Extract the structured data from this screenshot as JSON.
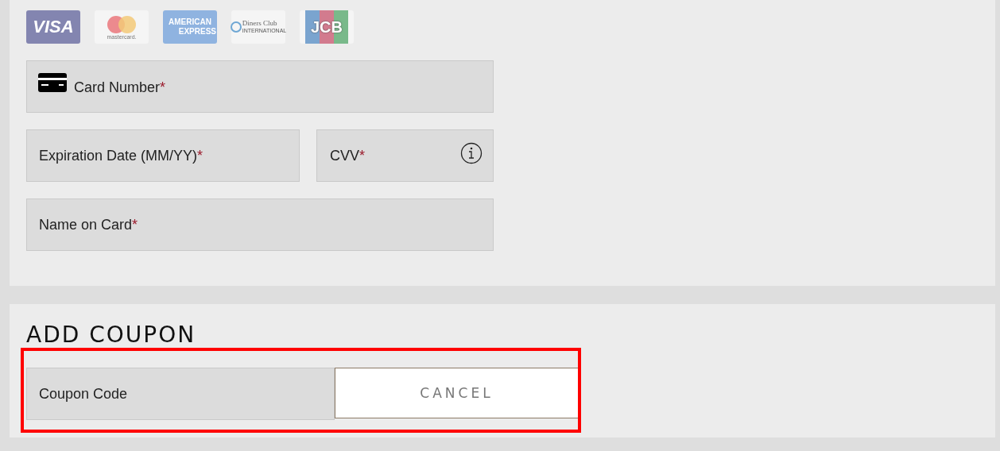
{
  "card_logos": [
    {
      "kind": "visa",
      "texts": [
        "VISA"
      ]
    },
    {
      "kind": "mastercard",
      "texts": [
        "mastercard."
      ]
    },
    {
      "kind": "amex",
      "texts": [
        "AMERICAN",
        "EXPRESS"
      ]
    },
    {
      "kind": "diners",
      "texts": [
        "Diners Club",
        "INTERNATIONAL"
      ]
    },
    {
      "kind": "jcb",
      "texts": [
        "JCB"
      ]
    }
  ],
  "payment_fields": [
    {
      "kind": "card_number",
      "placeholder": "Card Number",
      "required_mark": "*"
    },
    {
      "kind": "expiration",
      "placeholder": "Expiration Date (MM/YY)",
      "required_mark": "*"
    },
    {
      "kind": "cvv",
      "placeholder": "CVV",
      "required_mark": "*"
    },
    {
      "kind": "name",
      "placeholder": "Name on Card",
      "required_mark": "*"
    }
  ],
  "coupon": {
    "heading": "ADD COUPON",
    "placeholder": "Coupon Code",
    "button": "CANCEL",
    "highlighted": true
  }
}
